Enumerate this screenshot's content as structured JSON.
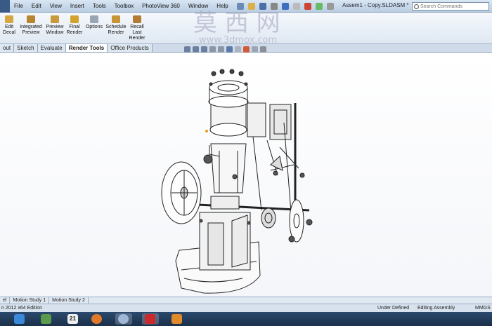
{
  "menubar": {
    "items": [
      "File",
      "Edit",
      "View",
      "Insert",
      "Tools",
      "Toolbox",
      "PhotoView 360",
      "Window",
      "Help"
    ],
    "doc_title": "Assem1 - Copy.SLDASM *",
    "search_placeholder": "Search Commands"
  },
  "commands": [
    {
      "label": "Edit\nDecal",
      "icon": "decal-icon"
    },
    {
      "label": "Integrated\nPreview",
      "icon": "integrated-preview-icon"
    },
    {
      "label": "Preview\nWindow",
      "icon": "preview-window-icon"
    },
    {
      "label": "Final\nRender",
      "icon": "final-render-icon"
    },
    {
      "label": "Options",
      "icon": "options-icon"
    },
    {
      "label": "Schedule\nRender",
      "icon": "schedule-render-icon"
    },
    {
      "label": "Recall\nLast\nRender",
      "icon": "recall-render-icon"
    }
  ],
  "tabs": [
    "out",
    "Sketch",
    "Evaluate",
    "Render Tools",
    "Office Products"
  ],
  "active_tab": "Render Tools",
  "watermark": {
    "big": "莫 西 网",
    "url": "www.3dmox.com"
  },
  "motion_tabs": [
    "el",
    "Motion Study 1",
    "Motion Study 2"
  ],
  "status": {
    "edition": "n 2012 x64 Edition",
    "defined": "Under Defined",
    "mode": "Editing Assembly",
    "units": "MMGS"
  },
  "taskbar": [
    "ie-icon",
    "explorer-icon",
    "calendar-icon",
    "firefox-icon",
    "chrome-icon",
    "solidworks-icon",
    "media-player-icon"
  ],
  "taskbar_calendar_day": "21",
  "colors": {
    "accent": "#3a5a86",
    "taskbar": "#1b2f49"
  }
}
